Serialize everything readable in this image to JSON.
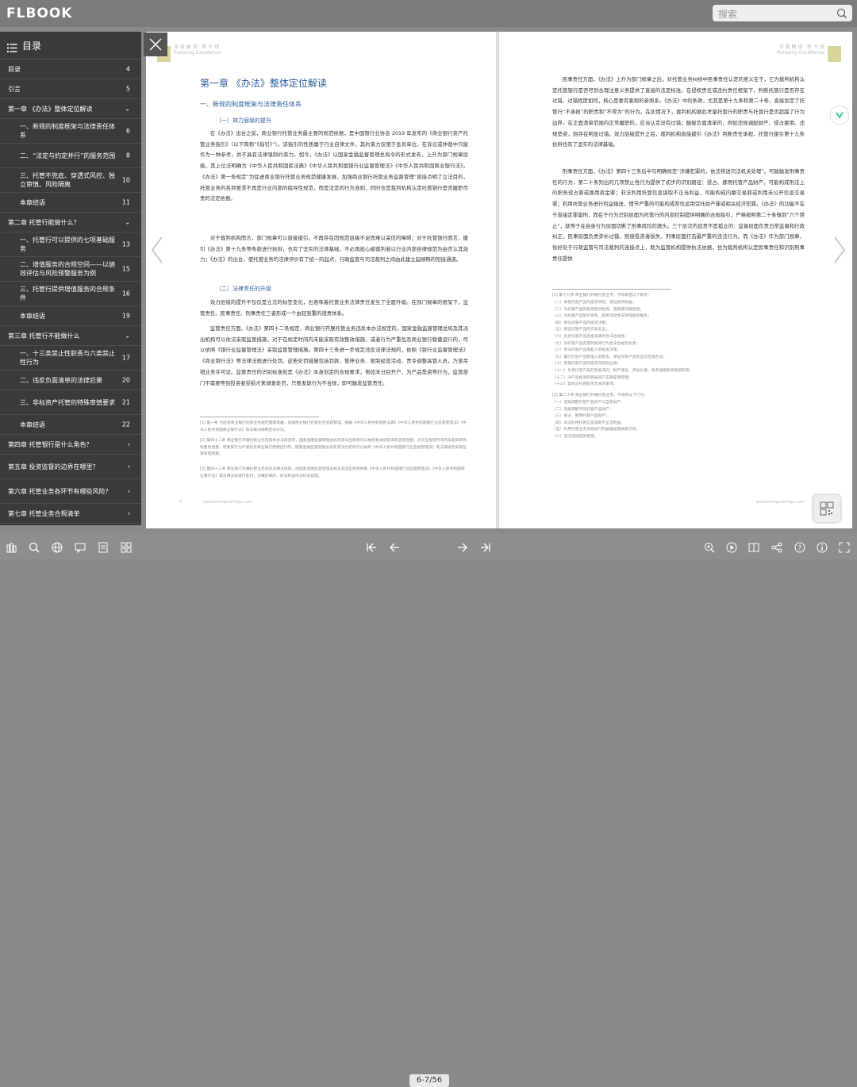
{
  "app": {
    "logo": "FLBOOK"
  },
  "search": {
    "placeholder": "搜索"
  },
  "toc": {
    "title": "目录",
    "items": [
      {
        "label": "目录",
        "page": "4",
        "level": 0
      },
      {
        "label": "引言",
        "page": "5",
        "level": 0
      },
      {
        "label": "第一章 《办法》整体定位解读",
        "page": "⌄",
        "level": 0
      },
      {
        "label": "一、新规的制度框架与法律责任体系",
        "page": "6",
        "level": 1
      },
      {
        "label": "二、“法定与约定并行”的服务范围",
        "page": "8",
        "level": 1
      },
      {
        "label": "三、托管不兜底、穿透式风控、独立审慎、风险隔离",
        "page": "10",
        "level": 1
      },
      {
        "label": "本章结语",
        "page": "11",
        "level": 1
      },
      {
        "label": "第二章 托管行能做什么？",
        "page": "⌄",
        "level": 0
      },
      {
        "label": "一、托管行可以提供的七项基础服务",
        "page": "13",
        "level": 1
      },
      {
        "label": "二、增值服务的合规空间——以绩效评估与风险预警服务为例",
        "page": "15",
        "level": 1
      },
      {
        "label": "三、托管行提供增值服务的合规条件",
        "page": "16",
        "level": 1
      },
      {
        "label": "本章结语",
        "page": "19",
        "level": 1
      },
      {
        "label": "第三章 托管行不能做什么",
        "page": "⌄",
        "level": 0
      },
      {
        "label": "一、十三类禁止性职责与六类禁止性行为",
        "page": "17",
        "level": 1
      },
      {
        "label": "二、违反负面清单的法律后果",
        "page": "20",
        "level": 1
      },
      {
        "label": "三、非标资产托管的特殊审慎要求",
        "page": "21",
        "level": 1
      },
      {
        "label": "本章结语",
        "page": "22",
        "level": 1
      },
      {
        "label": "第四章 托管银行是什么角色？",
        "page": "›",
        "level": 0
      },
      {
        "label": "第五章 投资监督的边界在哪里？",
        "page": "›",
        "level": 0
      },
      {
        "label": "第六章 托管业务各环节有哪些风险？",
        "page": "›",
        "level": 0
      },
      {
        "label": "第七章 托管业务合规清单",
        "page": "›",
        "level": 0
      }
    ]
  },
  "left_page": {
    "header": "深 度 解 读 · 新 干 线",
    "header_sub": "Pursuing Excellence",
    "chapter_title": "第一章 《办法》整体定位解读",
    "section1": "一、新规的制度框架与法律责任体系",
    "subsection1": "（一）效力层级的提升",
    "p1": "在《办法》出台之前，商业银行托管业务最主要的规范依据，是中国银行业协会 2019 年发布的《商业银行资产托管业务指引》（以下简称“《指引》”）。该指引的性质属于行业自律文件，其约束力仅限于会员单位，在诉讼或仲裁中只能作为一种参考，并不具有法律强制约束力。如今，《办法》以国家金融监督管理总局令的形式发布，上升为部门规章层级，其上位法明确为《中华人民共和国民法典》《中华人民共和国银行业监督管理法》《中华人民共和国商业银行法》。《办法》第一条规定“为促进商业银行托管业务规范健康发展，加强商业银行托管业务监督管理”直接点明了立法目的，托管业务的各项要求不再是行业内部的倡导性规范，而是法定的行为准则，同时也是裁判机构认定托管银行是否履职尽责的法定依据。",
    "p2": "对于裁判机构而言，部门规章可以直接援引，不再存在因规范层级不足而难以采信的障碍；对于托管银行而言，援引《办法》第十九条等条款进行抗辩，也有了坚实的法律基础，不必再担心被裁判者以行业内部自律规范为由否认其效力；《办法》的出台，使托管业务的法律评价有了统一的起点，行政监管与司法裁判之间由此建立起顺畅的衔接通道。",
    "subsection2": "（二）法律责任的升级",
    "p3": "效力层级的提升不仅仅是立法的标签变化，也意味着托管业务法律责任发生了全面升级。在部门规章的框架下，监管责任、民事责任、刑事责任三者形成一个由轻到重的递责体系。",
    "p4": "监管责任方面，《办法》第四十二条规定，商业银行开展托管业务违反本办法规定的，国家金融监督管理总局及其派出机构可以依法采取监管措施，对于在规定时间内未能采取有效整改措施，或者行为严重危及商业银行稳健运行的，可以依照《银行业监督管理法》采取监管管理措施。第四十三条进一步规定违反法律法规的，依照《银行业监督管理法》《商业银行法》等法律法规进行处罚。这些处罚措施包括罚款、暂停业务、限制经营活动、责令调整高管人员，乃至吊销业务许可证。监管责任的识别标准就是《办法》本身划定的合规要求，例如未分别开户、为产品垫资等行为，监管部门不需要等到投资者受损才来调查处罚，只要发现行为不合规，即可触发监管责任。",
    "fn1": "[1] 第一条 为促进商业银行托管业务规范健康发展，加强商业银行托管业务监督管理，根据《中华人民共和国民法典》《中华人民共和国银行业监督管理法》《中华人民共和国商业银行法》等法律法规制定本办法。",
    "fn2": "[2] 第四十二条 商业银行开展托管业务违反本办法规定的，国家金融监督管理总局及其派出机构可以依照有关规定采取监管措施；对于在规定时间内未能采取有效整改措施，或者其行为严重危及商业银行稳健运行的，国家金融监督管理总局及其派出机构可以依照《中华人民共和国银行业监督管理法》等法律规定采取监管管理措施。",
    "fn3": "[3] 第四十三条 商业银行开展托管业务违反法律法规的，由国家金融监督管理总局及其派出机构依照《中华人民共和国银行业监督管理法》《中华人民共和国商业银行法》等法律法规进行处罚；涉嫌犯罪的，依法移送司法机关处理。",
    "page_num": "6",
    "footer": "www.zhonglubridge.com"
  },
  "right_page": {
    "header": "深 度 解 读 · 新 干 线",
    "header_sub": "Pursuing Excellence",
    "p1": "民事责任方面，《办法》上升为部门规章之后，对托管业务纠纷中民事责任认定的意义在于，它为裁判机构认定托管银行是否尽到合理注意义务提供了直接的法定标准。在侵权责任或违约责任框架下，判断托管行是否存在过错、过错程度如何，核心是要有客观的参照系。《办法》中的条款，尤其是第十九条和第二十条，直接划定了托管行“不承担”的职责和“不得为”的行为。在此情况下，裁判机构据此考量托管行的职责与托管行是否超越了行为边界。在正面清单范围内正常履职的，应当认定没有过错；触碰负面清单的，例如违规调配财产、侵占挪用、违规垫资，则存在明显过错。效力层级提升之后，裁判机构直接援引《办法》判断责任承担，托管行援引第十九条抗辩也有了坚实的法律基础。",
    "p2": "刑事责任方面，《办法》第四十三条后半句明确规定“涉嫌犯罪的，依法移送司法机关处理”。可能触发刑事责任的行为，第二十条列出的几项禁止性行为提供了初步的识别路径：侵占、挪用托管产品财产，可能构成刑法上的职务侵占罪或挪用资金罪；非法利用托管信息谋取不正当利益，可能构成内幕交易罪或利用未公开信息交易罪；利用托管业务进行利益输送，情节严重的可能构成背信运用受托财产罪或相关经济犯罪。《办法》的功能不在于直接定罪量刑，而在于行为识别层面为托管行的内部控制提供明确的合规指引，严格按照第二十条做到“六个禁止”，就等于在自身行为层面切断了刑事风险的源头。三个层次的追责不是孤立的：监督层面负责日常监督和行政纠正，民事层面负责弥补过错、赔偿投资者损失，刑事层面打击最严重的违法行为。而《办法》作为部门规章，恰好处于行政监管与司法裁判的连接点上，既为监管机构提供执法依据，也为裁判机构认定民事责任和识别刑事责任提供",
    "fn_title1": "[1] 第十九条 商业银行开展托管业务，不得承担以下职责：",
    "fn_list1": [
      "（一）承担托管产品的投资风险，保证投资收益；",
      "（二）为托管产品的投资提供担保，直接或间接担保；",
      "（三）为托管产品垫付资金，提供流动性支持或融资服务；",
      "（四）参与托管产品的投资决策；",
      "（五）保证托管产品的交易安全；",
      "（六）负责托管产品资金来源的合法合规性；",
      "（七）对托管产品实施的投资行为合法合规性负责；",
      "（八）参与托管产品发起人的投资决策；",
      "（九）履行托管产品管理人的职责，保证托管产品的运作合规合法；",
      "（十）管理托管产品的投资风险及业绩；",
      "（十一）负责托管产品的资金流向、财产保全、评估价值、债务追偿和风险控制等；",
      "（十二）对产品投资的底层资产实施穿透管理；",
      "（十三）其他与托管职责无关的事项。"
    ],
    "fn_title2": "[2] 第二十条 商业银行开展托管业务，不得有以下行为：",
    "fn_list2": [
      "（一）违规调配托管产品财产与自有财产；",
      "（二）违规调配不同托管产品财产；",
      "（三）侵占、挪用托管产品财产；",
      "（四）非法利用托管信息谋取不正当利益；",
      "（五）利用托管业务违规进行利益输送或关联交易；",
      "（六）违法违规提供担保。"
    ],
    "footer": "www.zhonglubridge.com"
  },
  "bottom": {
    "page_indicator": "6-7/56"
  }
}
